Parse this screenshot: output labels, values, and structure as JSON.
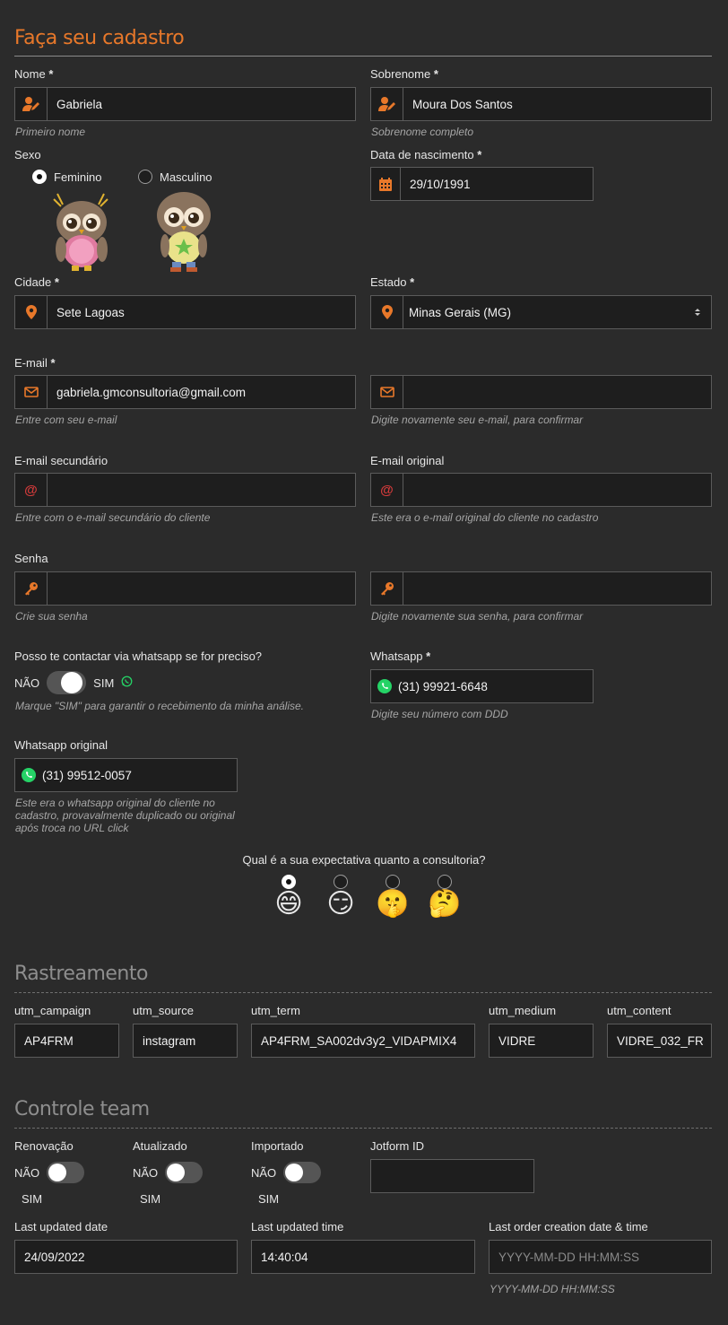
{
  "title": "Faça seu cadastro",
  "nome": {
    "label": "Nome",
    "req": "*",
    "value": "Gabriela",
    "hint": "Primeiro nome"
  },
  "sobrenome": {
    "label": "Sobrenome",
    "req": "*",
    "value": "Moura Dos Santos",
    "hint": "Sobrenome completo"
  },
  "sexo": {
    "label": "Sexo",
    "options": [
      "Feminino",
      "Masculino"
    ],
    "selected": "Feminino"
  },
  "nascimento": {
    "label": "Data de nascimento",
    "req": "*",
    "value": "29/10/1991"
  },
  "cidade": {
    "label": "Cidade",
    "req": "*",
    "value": "Sete Lagoas"
  },
  "estado": {
    "label": "Estado",
    "req": "*",
    "value": "Minas Gerais (MG)"
  },
  "email": {
    "label": "E-mail",
    "req": "*",
    "value": "gabriela.gmconsultoria@gmail.com",
    "hint": "Entre com seu e-mail",
    "confirm_value": "",
    "confirm_hint": "Digite novamente seu e-mail, para confirmar"
  },
  "email_sec": {
    "label": "E-mail secundário",
    "value": "",
    "hint": "Entre com o e-mail secundário do cliente"
  },
  "email_orig": {
    "label": "E-mail original",
    "value": "",
    "hint": "Este era o e-mail original do cliente no cadastro"
  },
  "senha": {
    "label": "Senha",
    "value": "",
    "hint": "Crie sua senha",
    "confirm_hint": "Digite novamente sua senha, para confirmar"
  },
  "whats_contact": {
    "label": "Posso te contactar via whatsapp se for preciso?",
    "no": "NÃO",
    "yes": "SIM",
    "hint": "Marque \"SIM\" para garantir o recebimento da minha análise."
  },
  "whatsapp": {
    "label": "Whatsapp",
    "req": "*",
    "value": "(31) 99921-6648",
    "hint": "Digite seu número com DDD"
  },
  "whats_orig": {
    "label": "Whatsapp original",
    "value": "(31) 99512-0057",
    "hint": "Este era o whatsapp original do cliente no cadastro, provavalmente duplicado ou original após troca no URL click"
  },
  "expectativa": {
    "label": "Qual é a sua expectativa quanto a consultoria?",
    "options": [
      "😄",
      "😏",
      "🤫",
      "🤔"
    ],
    "selected_index": 0
  },
  "rastreamento": {
    "title": "Rastreamento",
    "fields": [
      {
        "label": "utm_campaign",
        "value": "AP4FRM"
      },
      {
        "label": "utm_source",
        "value": "instagram"
      },
      {
        "label": "utm_term",
        "value": "AP4FRM_SA002dv3y2_VIDAPMIX4"
      },
      {
        "label": "utm_medium",
        "value": "VIDRE"
      },
      {
        "label": "utm_content",
        "value": "VIDRE_032_FR"
      }
    ]
  },
  "controle": {
    "title": "Controle team",
    "toggles": [
      {
        "label": "Renovação",
        "no": "NÃO",
        "yes": "SIM"
      },
      {
        "label": "Atualizado",
        "no": "NÃO",
        "yes": "SIM"
      },
      {
        "label": "Importado",
        "no": "NÃO",
        "yes": "SIM"
      }
    ],
    "jotform": {
      "label": "Jotform ID",
      "value": ""
    },
    "last_date": {
      "label": "Last updated date",
      "value": "24/09/2022"
    },
    "last_time": {
      "label": "Last updated time",
      "value": "14:40:04"
    },
    "last_order": {
      "label": "Last order creation date & time",
      "placeholder": "YYYY-MM-DD HH:MM:SS",
      "hint": "YYYY-MM-DD HH:MM:SS"
    }
  },
  "colors": {
    "accent": "#e8782a",
    "bg": "#2b2b2b",
    "field_bg": "#1e1e1e",
    "whatsapp": "#25d366",
    "at_icon": "#d33b3b"
  }
}
